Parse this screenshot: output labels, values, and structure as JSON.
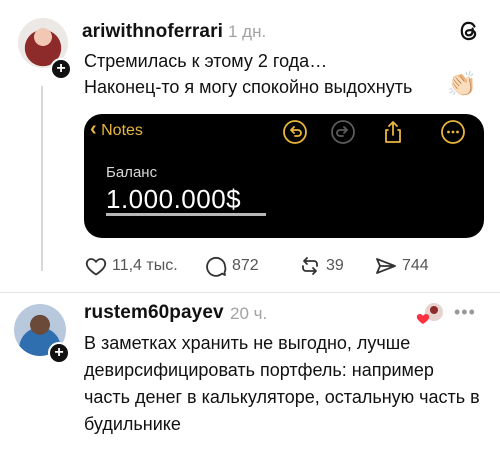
{
  "post": {
    "username": "ariwithnoferrari",
    "time": "1 дн.",
    "line1": "Стремилась к этому 2 года…",
    "line2": "Наконец-то я могу спокойно выдохнуть",
    "emoji": "👏🏻",
    "notes": {
      "back_label": "Notes",
      "balance_label": "Баланс",
      "balance_value": "1.000.000$",
      "accent": "#e9b63d"
    },
    "actions": {
      "likes": "11,4 тыс.",
      "comments": "872",
      "reposts": "39",
      "shares": "744"
    }
  },
  "reply": {
    "username": "rustem60payev",
    "time": "20 ч.",
    "more": "•••",
    "text": "В заметках хранить не выгодно, лучше девирсифицировать портфель: например часть денег в калькуляторе, остальную часть в будильнике"
  },
  "icons": {
    "app": "threads-logo-icon",
    "like": "heart-icon",
    "comment": "comment-bubble-icon",
    "repost": "repost-icon",
    "share": "share-send-icon"
  }
}
